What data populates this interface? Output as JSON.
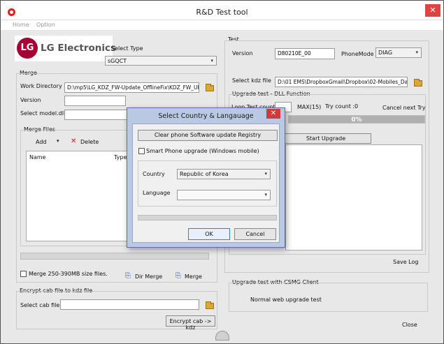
{
  "window": {
    "title": "R&D Test tool",
    "close_glyph": "✕"
  },
  "menu": [
    "Home",
    "Option"
  ],
  "logo": {
    "text": "LG Electronics",
    "mark": "LG"
  },
  "select_type": {
    "label": "Select Type",
    "value": "sGQCT"
  },
  "merge": {
    "legend": "Merge",
    "work_directory_label": "Work Directory",
    "work_directory_value": "D:\\mp5\\LG_KDZ_FW-Update_OfflineFix\\KDZ_FW_UF",
    "version_label": "Version",
    "version_value": "",
    "select_model_label": "Select model.dll",
    "select_model_value": "",
    "merge_files_legend": "Merge Files",
    "add_label": "Add",
    "delete_label": "Delete",
    "col_name": "Name",
    "col_type": "Type",
    "merge_size_label": "Merge 250-390MB size files.",
    "dir_merge_label": "Dir Merge",
    "merge_label": "Merge"
  },
  "encrypt": {
    "legend": "Encrypt cab file to kdz file",
    "select_cab_label": "Select cab file",
    "select_cab_value": "",
    "encrypt_button": "Encrypt cab -> kdz"
  },
  "test": {
    "legend": "Test",
    "version_label": "Version",
    "version_value": "D80210E_00",
    "phonemode_label": "PhoneMode",
    "phonemode_value": "DIAG",
    "select_kdz_label": "Select kdz file",
    "select_kdz_value": "D:\\01 EMS\\DropboxGmail\\Dropbox\\02-Mobiles_Data\\",
    "upgrade_dll_legend": "Upgrade test - DLL Function",
    "loop_test_label": "Loop Test count",
    "loop_test_value": "",
    "max_label": "MAX(15)",
    "try_count_label": "Try count :",
    "try_count_value": "0",
    "cancel_next_try_label": "Cancel next Try",
    "progress_text": "0%",
    "progress_value": 0,
    "start_upgrade_button": "Start Upgrade",
    "save_log_label": "Save Log",
    "csmg_legend": "Upgrade test with CSMG Client",
    "normal_web_label": "Normal web upgrade test",
    "close_label": "Close"
  },
  "dialog": {
    "title": "Select Country & Langauage",
    "close_glyph": "✕",
    "clear_registry_button": "Clear phone Software update Registry",
    "smartphone_checkbox_label": "Smart Phone upgrade (Windows mobile)",
    "country_label": "Country",
    "country_value": "Republic of Korea",
    "language_label": "Language",
    "language_value": "",
    "ok_button": "OK",
    "cancel_button": "Cancel"
  },
  "icons": {
    "dropdown_arrow": "▾",
    "delete_glyph": "✕",
    "add_arrow": "▾"
  },
  "colors": {
    "progress_green": "#b0b0b0",
    "lg_red": "#a50034",
    "dialog_frame": "#b9c9e4",
    "close_red": "#e04343"
  }
}
